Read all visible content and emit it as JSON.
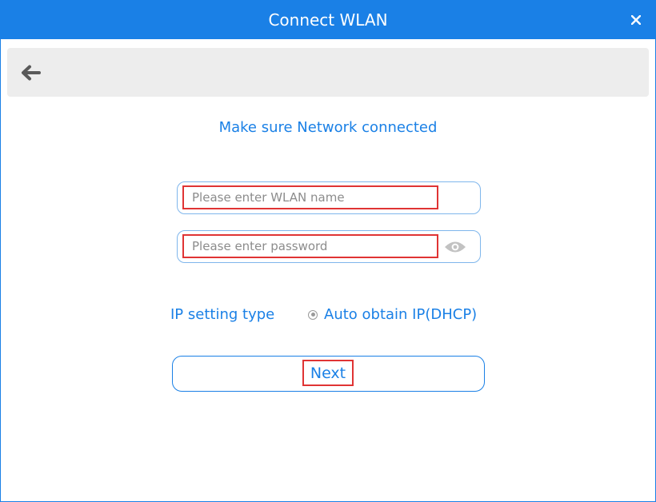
{
  "window": {
    "title": "Connect WLAN",
    "close_icon": "close-icon",
    "accent_color": "#1a80e6"
  },
  "toolbar": {
    "back_icon": "back-arrow-icon"
  },
  "main": {
    "heading": "Make sure Network connected",
    "wlan_name": {
      "value": "",
      "placeholder": "Please enter WLAN name"
    },
    "password": {
      "value": "",
      "placeholder": "Please enter password",
      "toggle_icon": "eye-icon"
    },
    "ip_setting": {
      "label": "IP setting type",
      "selected_option": "Auto obtain IP(DHCP)"
    },
    "next_label": "Next"
  }
}
